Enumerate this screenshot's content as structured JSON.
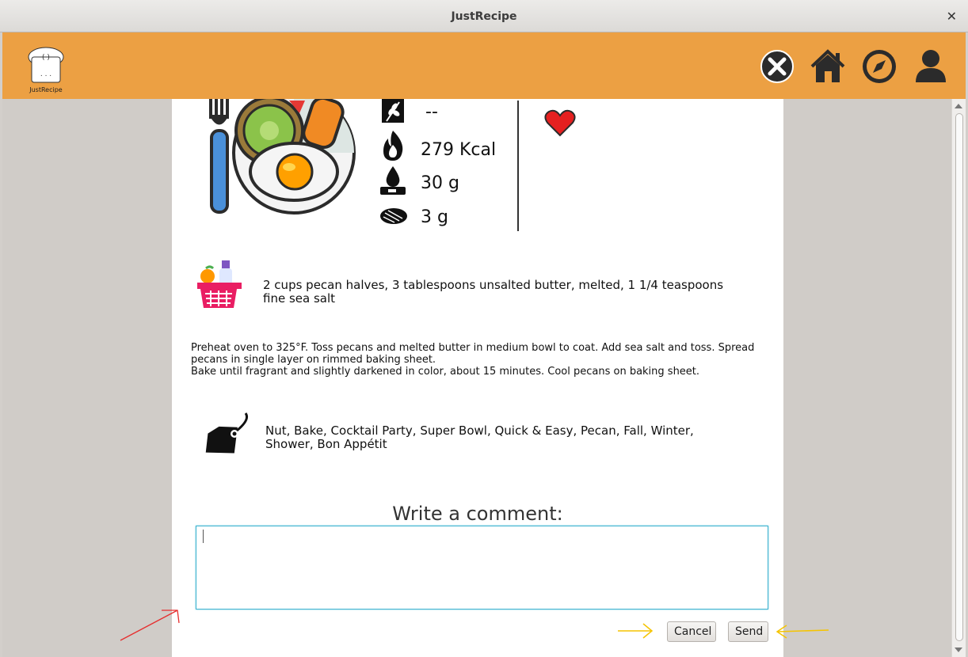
{
  "window": {
    "title": "JustRecipe"
  },
  "header": {
    "logo_text": "JustRecipe",
    "accent_color": "#eca043"
  },
  "nav": {
    "icons": [
      "close-circle-icon",
      "home-icon",
      "compass-icon",
      "user-icon"
    ]
  },
  "recipe": {
    "nutrition": [
      {
        "icon": "wheat-icon",
        "value": "--"
      },
      {
        "icon": "flame-icon",
        "value": "279 Kcal"
      },
      {
        "icon": "fat-drop-icon",
        "value": "30 g"
      },
      {
        "icon": "meat-protein-icon",
        "value": "3 g"
      }
    ],
    "ingredients": "2 cups pecan halves, 3 tablespoons unsalted butter, melted, 1 1/4 teaspoons fine sea salt",
    "instructions_line1": "Preheat oven to 325°F. Toss pecans and melted butter in medium bowl to coat. Add sea salt and toss. Spread pecans in single layer on rimmed baking sheet.",
    "instructions_line2": "Bake until fragrant and slightly darkened in color, about 15 minutes. Cool pecans on baking sheet.",
    "tags": "Nut, Bake, Cocktail Party, Super Bowl, Quick & Easy, Pecan, Fall, Winter, Shower, Bon Appétit"
  },
  "comment": {
    "label": "Write a comment:",
    "value": "",
    "cancel_label": "Cancel",
    "send_label": "Send"
  }
}
